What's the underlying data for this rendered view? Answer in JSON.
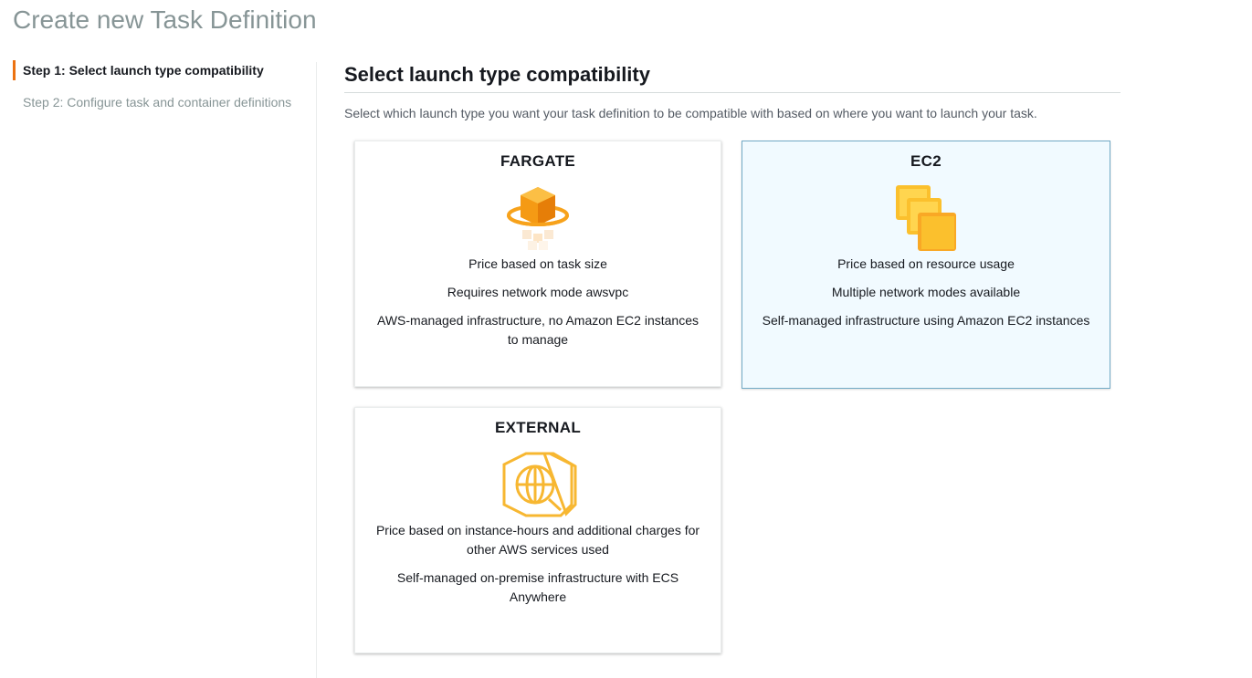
{
  "page": {
    "title": "Create new Task Definition"
  },
  "steps": [
    {
      "label": "Step 1: Select launch type compatibility"
    },
    {
      "label": "Step 2: Configure task and container definitions"
    }
  ],
  "section": {
    "title": "Select launch type compatibility",
    "description": "Select which launch type you want your task definition to be compatible with based on where you want to launch your task."
  },
  "cards": {
    "fargate": {
      "title": "FARGATE",
      "icon": "fargate-icon",
      "lines": [
        "Price based on task size",
        "Requires network mode awsvpc",
        "AWS-managed infrastructure, no Amazon EC2 instances to manage"
      ]
    },
    "ec2": {
      "title": "EC2",
      "icon": "ec2-instances-icon",
      "lines": [
        "Price based on resource usage",
        "Multiple network modes available",
        "Self-managed infrastructure using Amazon EC2 instances"
      ]
    },
    "external": {
      "title": "EXTERNAL",
      "icon": "ecs-anywhere-globe-icon",
      "lines": [
        "Price based on instance-hours and additional charges for other AWS services used",
        "Self-managed on-premise infrastructure with ECS Anywhere"
      ]
    }
  },
  "colors": {
    "accent": "#ec7211",
    "selected_bg": "#f1faff",
    "selected_border": "#72aac6",
    "muted_text": "#879596"
  }
}
